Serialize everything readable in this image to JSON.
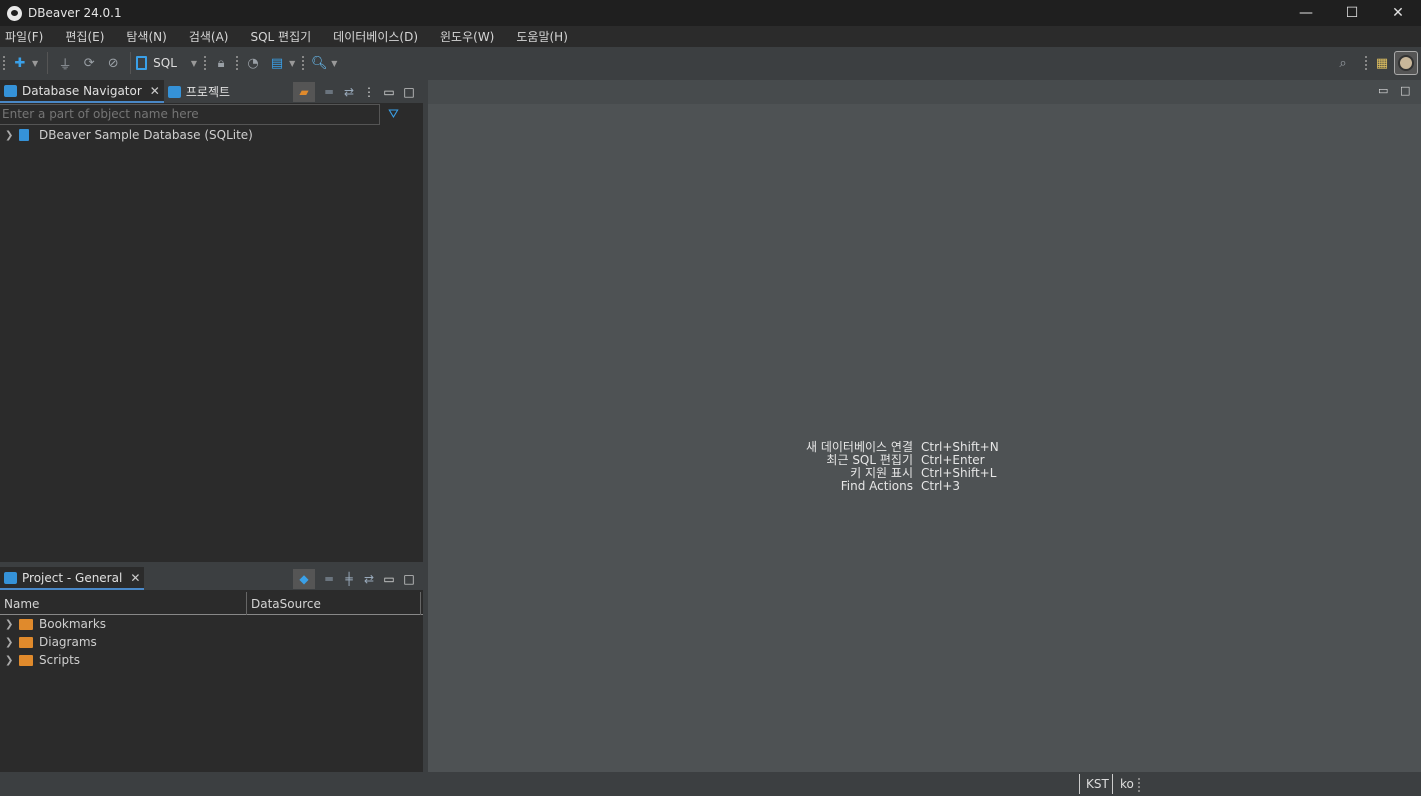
{
  "window": {
    "title": "DBeaver 24.0.1",
    "minimize": "—",
    "maximize": "☐",
    "close": "✕"
  },
  "menu": [
    "파일(F)",
    "편집(E)",
    "탐색(N)",
    "검색(A)",
    "SQL 편집기",
    "데이터베이스(D)",
    "윈도우(W)",
    "도움말(H)"
  ],
  "toolbar": {
    "sql_label": "SQL"
  },
  "navigator": {
    "tab_active": "Database Navigator",
    "tab_other": "프로젝트",
    "filter_placeholder": "Enter a part of object name here",
    "items": [
      {
        "label": "DBeaver Sample Database (SQLite)"
      }
    ]
  },
  "project": {
    "tab": "Project - General",
    "columns": [
      "Name",
      "DataSource"
    ],
    "items": [
      {
        "label": "Bookmarks"
      },
      {
        "label": "Diagrams"
      },
      {
        "label": "Scripts"
      }
    ]
  },
  "editor_hints": [
    {
      "action": "새 데이터베이스 연결",
      "shortcut": "Ctrl+Shift+N"
    },
    {
      "action": "최근 SQL 편집기",
      "shortcut": "Ctrl+Enter"
    },
    {
      "action": "키 지원 표시",
      "shortcut": "Ctrl+Shift+L"
    },
    {
      "action": "Find Actions",
      "shortcut": "Ctrl+3"
    }
  ],
  "status": {
    "timezone": "KST",
    "locale": "ko"
  },
  "colors": {
    "accent": "#3592d8",
    "folder": "#e08a2c",
    "editor_bg": "#4e5254",
    "panel_bg": "#2b2b2b"
  }
}
